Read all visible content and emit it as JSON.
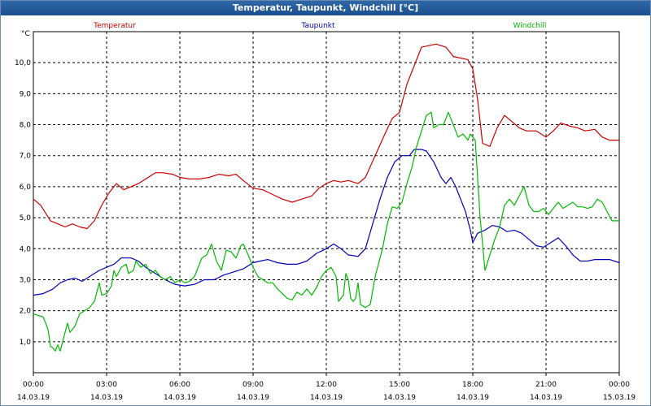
{
  "window": {
    "title": "Temperatur, Taupunkt, Windchill [°C]"
  },
  "chart_data": {
    "type": "line",
    "title": "Temperatur, Taupunkt, Windchill [°C]",
    "ylabel": "°C",
    "ylim": [
      0,
      11
    ],
    "yticks": [
      {
        "value": 1,
        "label": "1,0"
      },
      {
        "value": 2,
        "label": "2,0"
      },
      {
        "value": 3,
        "label": "3,0"
      },
      {
        "value": 4,
        "label": "4,0"
      },
      {
        "value": 5,
        "label": "5,0"
      },
      {
        "value": 6,
        "label": "6,0"
      },
      {
        "value": 7,
        "label": "7,0"
      },
      {
        "value": 8,
        "label": "8,0"
      },
      {
        "value": 9,
        "label": "9,0"
      },
      {
        "value": 10,
        "label": "10,0"
      }
    ],
    "xlim": [
      0,
      24
    ],
    "xticks": [
      {
        "value": 0,
        "time": "00:00",
        "date": "14.03.19"
      },
      {
        "value": 3,
        "time": "03:00",
        "date": "14.03.19"
      },
      {
        "value": 6,
        "time": "06:00",
        "date": "14.03.19"
      },
      {
        "value": 9,
        "time": "09:00",
        "date": "14.03.19"
      },
      {
        "value": 12,
        "time": "12:00",
        "date": "14.03.19"
      },
      {
        "value": 15,
        "time": "15:00",
        "date": "14.03.19"
      },
      {
        "value": 18,
        "time": "18:00",
        "date": "14.03.19"
      },
      {
        "value": 21,
        "time": "21:00",
        "date": "14.03.19"
      },
      {
        "value": 24,
        "time": "00:00",
        "date": "15.03.19"
      }
    ],
    "grid": true,
    "legend": "top",
    "series": [
      {
        "name": "Temperatur",
        "color": "#cc0000",
        "points": [
          [
            0,
            5.6
          ],
          [
            0.3,
            5.4
          ],
          [
            0.7,
            4.9
          ],
          [
            1.0,
            4.8
          ],
          [
            1.3,
            4.7
          ],
          [
            1.6,
            4.8
          ],
          [
            1.9,
            4.7
          ],
          [
            2.2,
            4.65
          ],
          [
            2.5,
            4.9
          ],
          [
            2.8,
            5.4
          ],
          [
            3.1,
            5.8
          ],
          [
            3.4,
            6.1
          ],
          [
            3.7,
            5.9
          ],
          [
            4.0,
            6.0
          ],
          [
            4.3,
            6.1
          ],
          [
            4.7,
            6.3
          ],
          [
            5.0,
            6.45
          ],
          [
            5.3,
            6.45
          ],
          [
            5.7,
            6.4
          ],
          [
            6.0,
            6.3
          ],
          [
            6.4,
            6.25
          ],
          [
            6.8,
            6.25
          ],
          [
            7.2,
            6.3
          ],
          [
            7.6,
            6.4
          ],
          [
            8.0,
            6.35
          ],
          [
            8.3,
            6.4
          ],
          [
            8.6,
            6.2
          ],
          [
            9.0,
            5.95
          ],
          [
            9.4,
            5.9
          ],
          [
            9.8,
            5.75
          ],
          [
            10.2,
            5.6
          ],
          [
            10.6,
            5.5
          ],
          [
            11.0,
            5.6
          ],
          [
            11.4,
            5.7
          ],
          [
            11.7,
            5.95
          ],
          [
            12.0,
            6.1
          ],
          [
            12.3,
            6.2
          ],
          [
            12.6,
            6.15
          ],
          [
            12.9,
            6.2
          ],
          [
            13.3,
            6.1
          ],
          [
            13.6,
            6.3
          ],
          [
            14.0,
            7.0
          ],
          [
            14.4,
            7.7
          ],
          [
            14.7,
            8.2
          ],
          [
            15.0,
            8.4
          ],
          [
            15.3,
            9.3
          ],
          [
            15.6,
            9.9
          ],
          [
            15.9,
            10.5
          ],
          [
            16.2,
            10.55
          ],
          [
            16.5,
            10.6
          ],
          [
            16.9,
            10.5
          ],
          [
            17.2,
            10.2
          ],
          [
            17.5,
            10.15
          ],
          [
            17.8,
            10.1
          ],
          [
            18.0,
            9.8
          ],
          [
            18.2,
            8.8
          ],
          [
            18.4,
            7.4
          ],
          [
            18.7,
            7.3
          ],
          [
            19.0,
            7.9
          ],
          [
            19.3,
            8.3
          ],
          [
            19.6,
            8.1
          ],
          [
            19.9,
            7.9
          ],
          [
            20.2,
            7.8
          ],
          [
            20.6,
            7.8
          ],
          [
            21.0,
            7.6
          ],
          [
            21.3,
            7.8
          ],
          [
            21.6,
            8.05
          ],
          [
            22.0,
            7.95
          ],
          [
            22.3,
            7.9
          ],
          [
            22.6,
            7.8
          ],
          [
            23.0,
            7.85
          ],
          [
            23.3,
            7.6
          ],
          [
            23.6,
            7.5
          ],
          [
            24.0,
            7.5
          ]
        ]
      },
      {
        "name": "Taupunkt",
        "color": "#0000bb",
        "points": [
          [
            0,
            2.5
          ],
          [
            0.4,
            2.55
          ],
          [
            0.8,
            2.7
          ],
          [
            1.1,
            2.9
          ],
          [
            1.4,
            3.0
          ],
          [
            1.7,
            3.05
          ],
          [
            2.0,
            2.95
          ],
          [
            2.3,
            3.1
          ],
          [
            2.7,
            3.3
          ],
          [
            3.0,
            3.4
          ],
          [
            3.3,
            3.5
          ],
          [
            3.6,
            3.7
          ],
          [
            4.0,
            3.7
          ],
          [
            4.3,
            3.6
          ],
          [
            4.6,
            3.4
          ],
          [
            5.0,
            3.2
          ],
          [
            5.4,
            3.0
          ],
          [
            5.8,
            2.85
          ],
          [
            6.2,
            2.8
          ],
          [
            6.6,
            2.85
          ],
          [
            7.0,
            3.0
          ],
          [
            7.4,
            3.0
          ],
          [
            7.8,
            3.15
          ],
          [
            8.2,
            3.25
          ],
          [
            8.6,
            3.35
          ],
          [
            9.0,
            3.55
          ],
          [
            9.3,
            3.6
          ],
          [
            9.6,
            3.65
          ],
          [
            10.0,
            3.55
          ],
          [
            10.4,
            3.5
          ],
          [
            10.8,
            3.5
          ],
          [
            11.2,
            3.6
          ],
          [
            11.6,
            3.85
          ],
          [
            12.0,
            4.0
          ],
          [
            12.3,
            4.15
          ],
          [
            12.6,
            4.0
          ],
          [
            12.9,
            3.8
          ],
          [
            13.3,
            3.75
          ],
          [
            13.6,
            4.0
          ],
          [
            13.9,
            4.8
          ],
          [
            14.2,
            5.6
          ],
          [
            14.5,
            6.3
          ],
          [
            14.8,
            6.8
          ],
          [
            15.1,
            7.0
          ],
          [
            15.4,
            7.0
          ],
          [
            15.6,
            7.2
          ],
          [
            15.9,
            7.2
          ],
          [
            16.1,
            7.15
          ],
          [
            16.4,
            6.8
          ],
          [
            16.7,
            6.3
          ],
          [
            16.9,
            6.1
          ],
          [
            17.1,
            6.3
          ],
          [
            17.3,
            6.0
          ],
          [
            17.5,
            5.6
          ],
          [
            17.7,
            5.2
          ],
          [
            17.9,
            4.6
          ],
          [
            18.0,
            4.2
          ],
          [
            18.2,
            4.5
          ],
          [
            18.5,
            4.6
          ],
          [
            18.8,
            4.75
          ],
          [
            19.1,
            4.7
          ],
          [
            19.4,
            4.55
          ],
          [
            19.7,
            4.6
          ],
          [
            20.0,
            4.5
          ],
          [
            20.3,
            4.3
          ],
          [
            20.6,
            4.1
          ],
          [
            20.9,
            4.05
          ],
          [
            21.2,
            4.2
          ],
          [
            21.5,
            4.35
          ],
          [
            21.8,
            4.1
          ],
          [
            22.1,
            3.8
          ],
          [
            22.4,
            3.6
          ],
          [
            22.7,
            3.6
          ],
          [
            23.0,
            3.65
          ],
          [
            23.3,
            3.65
          ],
          [
            23.6,
            3.65
          ],
          [
            24.0,
            3.55
          ]
        ]
      },
      {
        "name": "Windchill",
        "color": "#00bb00",
        "points": [
          [
            0,
            1.9
          ],
          [
            0.2,
            1.85
          ],
          [
            0.4,
            1.8
          ],
          [
            0.6,
            1.4
          ],
          [
            0.7,
            0.85
          ],
          [
            0.8,
            0.8
          ],
          [
            0.9,
            0.7
          ],
          [
            1.0,
            0.9
          ],
          [
            1.1,
            0.7
          ],
          [
            1.2,
            1.0
          ],
          [
            1.4,
            1.6
          ],
          [
            1.5,
            1.3
          ],
          [
            1.7,
            1.5
          ],
          [
            1.9,
            1.9
          ],
          [
            2.1,
            2.0
          ],
          [
            2.3,
            2.1
          ],
          [
            2.5,
            2.3
          ],
          [
            2.7,
            2.9
          ],
          [
            2.8,
            2.5
          ],
          [
            3.0,
            2.55
          ],
          [
            3.2,
            2.8
          ],
          [
            3.3,
            3.3
          ],
          [
            3.4,
            3.1
          ],
          [
            3.6,
            3.4
          ],
          [
            3.8,
            3.5
          ],
          [
            3.9,
            3.2
          ],
          [
            4.1,
            3.3
          ],
          [
            4.2,
            3.6
          ],
          [
            4.4,
            3.4
          ],
          [
            4.6,
            3.5
          ],
          [
            4.8,
            3.2
          ],
          [
            5.0,
            3.3
          ],
          [
            5.2,
            3.1
          ],
          [
            5.4,
            3.0
          ],
          [
            5.6,
            3.1
          ],
          [
            5.8,
            2.9
          ],
          [
            6.0,
            3.0
          ],
          [
            6.2,
            2.9
          ],
          [
            6.4,
            2.95
          ],
          [
            6.6,
            3.1
          ],
          [
            6.9,
            3.7
          ],
          [
            7.1,
            3.8
          ],
          [
            7.3,
            4.15
          ],
          [
            7.5,
            3.6
          ],
          [
            7.7,
            3.3
          ],
          [
            7.9,
            3.95
          ],
          [
            8.1,
            3.9
          ],
          [
            8.3,
            3.7
          ],
          [
            8.5,
            4.1
          ],
          [
            8.6,
            4.15
          ],
          [
            8.8,
            3.8
          ],
          [
            9.0,
            3.4
          ],
          [
            9.2,
            3.1
          ],
          [
            9.4,
            3.0
          ],
          [
            9.6,
            2.9
          ],
          [
            9.8,
            2.9
          ],
          [
            10.0,
            2.7
          ],
          [
            10.2,
            2.55
          ],
          [
            10.4,
            2.4
          ],
          [
            10.6,
            2.35
          ],
          [
            10.8,
            2.6
          ],
          [
            11.0,
            2.5
          ],
          [
            11.2,
            2.7
          ],
          [
            11.4,
            2.5
          ],
          [
            11.6,
            2.75
          ],
          [
            11.8,
            3.1
          ],
          [
            12.0,
            3.3
          ],
          [
            12.2,
            3.4
          ],
          [
            12.4,
            3.1
          ],
          [
            12.5,
            2.3
          ],
          [
            12.7,
            2.5
          ],
          [
            12.8,
            3.2
          ],
          [
            12.9,
            3.0
          ],
          [
            13.0,
            2.4
          ],
          [
            13.1,
            2.3
          ],
          [
            13.2,
            2.4
          ],
          [
            13.3,
            2.9
          ],
          [
            13.4,
            2.2
          ],
          [
            13.6,
            2.1
          ],
          [
            13.8,
            2.2
          ],
          [
            14.0,
            3.1
          ],
          [
            14.3,
            4.0
          ],
          [
            14.5,
            4.8
          ],
          [
            14.7,
            5.35
          ],
          [
            14.9,
            5.3
          ],
          [
            15.1,
            5.5
          ],
          [
            15.3,
            6.1
          ],
          [
            15.5,
            6.6
          ],
          [
            15.7,
            7.3
          ],
          [
            15.9,
            7.8
          ],
          [
            16.1,
            8.3
          ],
          [
            16.3,
            8.4
          ],
          [
            16.4,
            7.9
          ],
          [
            16.6,
            8.0
          ],
          [
            16.8,
            8.0
          ],
          [
            17.0,
            8.4
          ],
          [
            17.2,
            8.0
          ],
          [
            17.4,
            7.6
          ],
          [
            17.6,
            7.7
          ],
          [
            17.8,
            7.5
          ],
          [
            17.9,
            7.7
          ],
          [
            18.1,
            7.5
          ],
          [
            18.3,
            5.0
          ],
          [
            18.5,
            3.3
          ],
          [
            18.7,
            3.8
          ],
          [
            18.9,
            4.3
          ],
          [
            19.1,
            4.7
          ],
          [
            19.3,
            5.4
          ],
          [
            19.5,
            5.6
          ],
          [
            19.7,
            5.4
          ],
          [
            19.9,
            5.7
          ],
          [
            20.1,
            6.0
          ],
          [
            20.3,
            5.4
          ],
          [
            20.5,
            5.2
          ],
          [
            20.7,
            5.2
          ],
          [
            20.9,
            5.3
          ],
          [
            21.1,
            5.1
          ],
          [
            21.3,
            5.3
          ],
          [
            21.5,
            5.5
          ],
          [
            21.7,
            5.3
          ],
          [
            21.9,
            5.4
          ],
          [
            22.1,
            5.5
          ],
          [
            22.3,
            5.35
          ],
          [
            22.5,
            5.35
          ],
          [
            22.7,
            5.3
          ],
          [
            22.9,
            5.35
          ],
          [
            23.1,
            5.6
          ],
          [
            23.3,
            5.5
          ],
          [
            23.5,
            5.2
          ],
          [
            23.7,
            4.9
          ],
          [
            24.0,
            4.9
          ]
        ]
      }
    ]
  }
}
